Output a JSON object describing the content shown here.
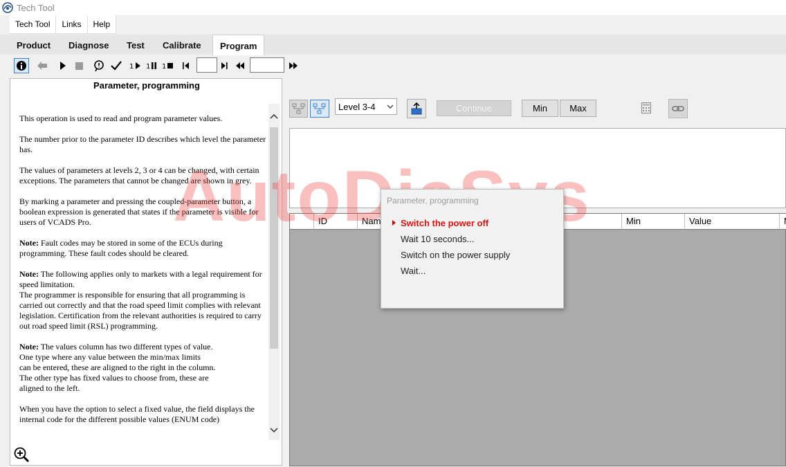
{
  "window": {
    "title": "Tech Tool"
  },
  "menu": [
    "Tech Tool",
    "Links",
    "Help"
  ],
  "tabs": [
    {
      "label": "Product",
      "active": false
    },
    {
      "label": "Diagnose",
      "active": false
    },
    {
      "label": "Test",
      "active": false
    },
    {
      "label": "Calibrate",
      "active": false
    },
    {
      "label": "Program",
      "active": true
    }
  ],
  "toolbar": {
    "icons": [
      "info-icon",
      "back-arrow-icon",
      "play-icon",
      "stop-icon",
      "inspect-icon",
      "checkmark-icon",
      "step-play-icon",
      "step-pause-icon",
      "step-stop-icon",
      "first-icon",
      "last-icon",
      "rewind-icon",
      "fast-forward-icon"
    ],
    "field1_value": "",
    "field2_value": ""
  },
  "help": {
    "title": "Parameter, programming",
    "paragraphs": [
      {
        "bold": "",
        "text": "This operation is used to read and program parameter values."
      },
      {
        "bold": "",
        "text": "The number prior to the parameter ID describes which level the parameter has."
      },
      {
        "bold": "",
        "text": "The values of parameters at levels 2, 3 or 4 can be changed, with certain exceptions. The parameters that cannot be changed are shown in grey."
      },
      {
        "bold": "",
        "text": "By marking a parameter and pressing the coupled-parameter button, a boolean expression is generated that states if the parameter is visible for users of VCADS Pro."
      },
      {
        "bold": "Note:",
        "text": " Fault codes may be stored in some of the ECUs during programming. These fault codes should be cleared."
      },
      {
        "bold": "Note:",
        "text": " The following applies only to markets with a legal requirement for speed limitation.\nThe programmer is responsible for ensuring that all programming is carried out correctly and that the road speed limit complies with relevant legislation. Certification from the relevant authorities is required to carry out road speed limit (RSL) programming."
      },
      {
        "bold": "Note:",
        "text": " The values column has two different types of value.\nOne type where any value between the min/max limits\ncan be entered, these are aligned to the right in the column.\nThe other type has fixed values to choose from, these are\naligned to the left."
      },
      {
        "bold": "",
        "text": "When you have the option to select a fixed value, the field displays the internal code for the different possible values (ENUM code)"
      }
    ]
  },
  "controls": {
    "level_select": "Level 3-4",
    "continue_label": "Continue",
    "min_label": "Min",
    "max_label": "Max"
  },
  "grid": {
    "columns": [
      "ID",
      "Name",
      "Min",
      "Value",
      "M"
    ]
  },
  "popup": {
    "title": "Parameter, programming",
    "steps": [
      {
        "label": "Switch the power off",
        "current": true
      },
      {
        "label": "Wait 10 seconds...",
        "current": false
      },
      {
        "label": "Switch on the power supply",
        "current": false
      },
      {
        "label": "Wait...",
        "current": false
      }
    ]
  },
  "watermark": "AutoDiaSys",
  "colors": {
    "accent_red": "#d11111",
    "grid_bg": "#ababab",
    "select_blue": "#3c7fd6"
  }
}
